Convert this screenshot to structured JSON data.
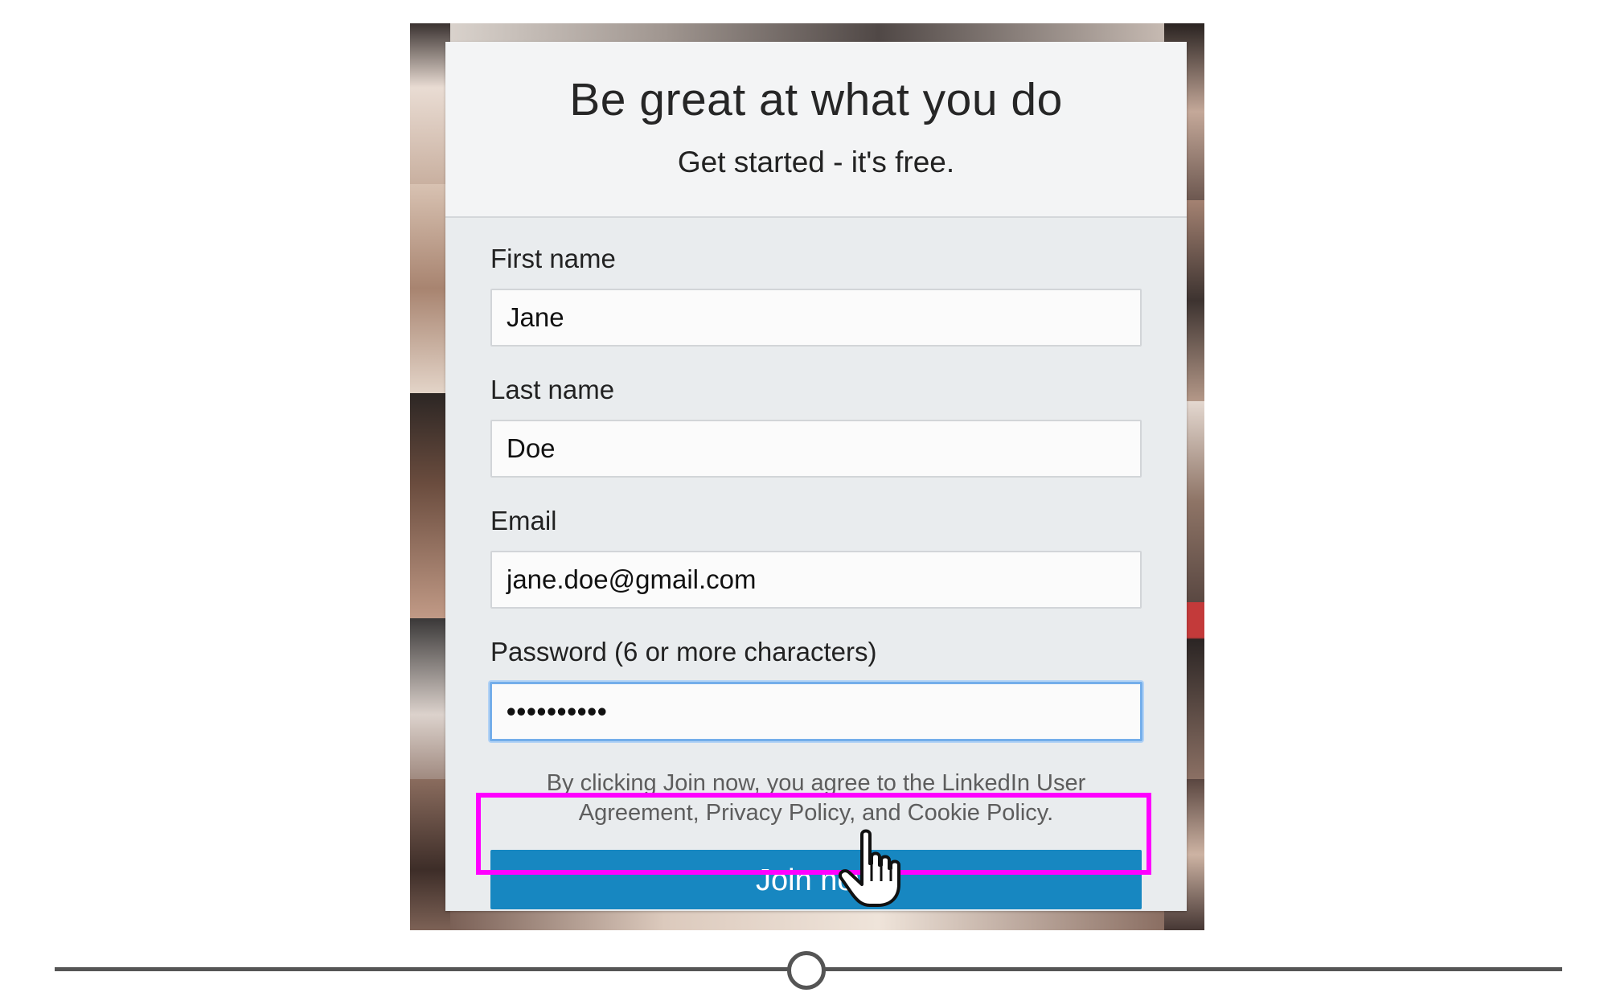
{
  "card": {
    "headline": "Be great at what you do",
    "subhead": "Get started - it's free."
  },
  "form": {
    "first_name_label": "First name",
    "first_name_value": "Jane",
    "last_name_label": "Last name",
    "last_name_value": "Doe",
    "email_label": "Email",
    "email_value": "jane.doe@gmail.com",
    "password_label": "Password (6 or more characters)",
    "password_value": "••••••••••"
  },
  "agreement_text_line1": "By clicking Join now, you agree to the LinkedIn User",
  "agreement_text_line2": "Agreement, Privacy Policy, and Cookie Policy.",
  "join_button_label": "Join now",
  "colors": {
    "primary_button": "#1787c1",
    "highlight": "#ff00ff",
    "focus_border": "#74aeea"
  },
  "icons": {
    "cursor": "hand-pointer-icon"
  },
  "slider": {
    "value_fraction": 0.5
  }
}
